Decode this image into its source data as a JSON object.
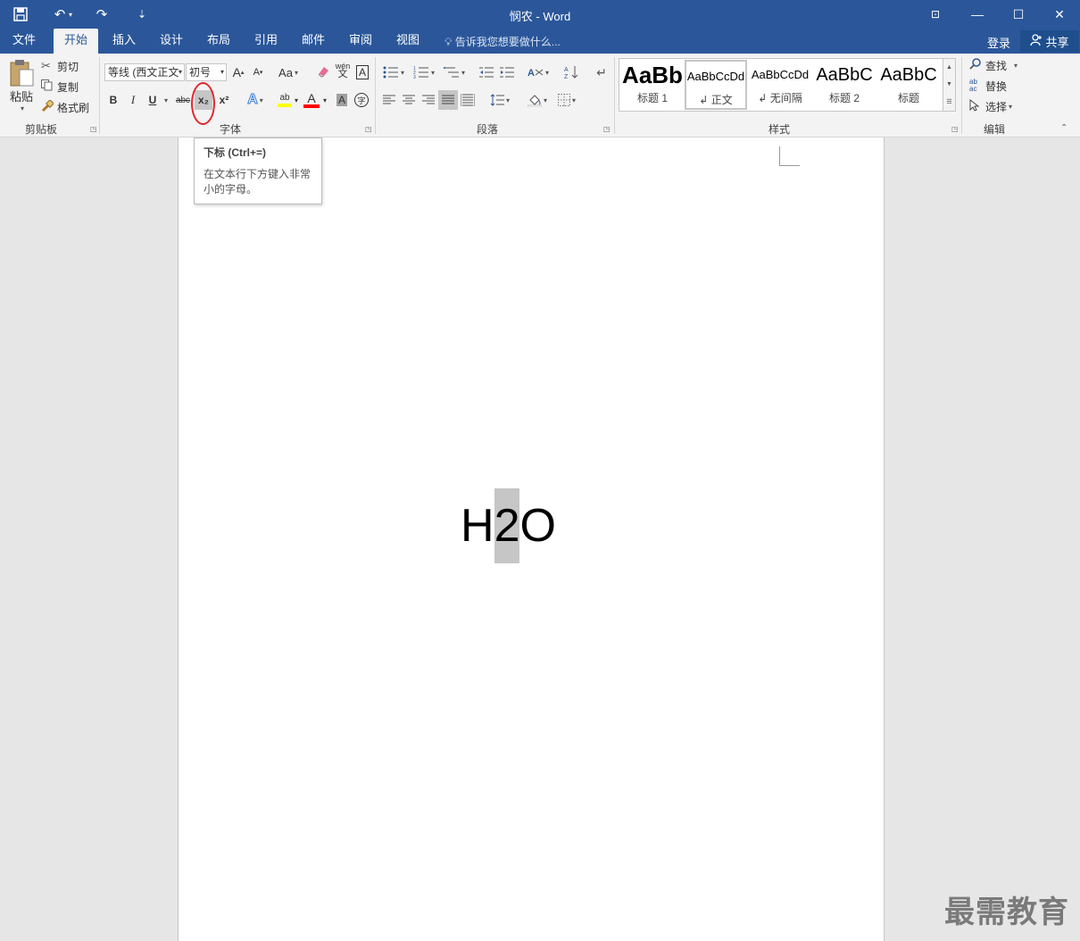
{
  "window": {
    "title": "悯农 - Word",
    "min_icon": "—",
    "max_icon": "☐",
    "close_icon": "✕",
    "ribbon_opts_icon": "⊡"
  },
  "quick_access": {
    "save_icon": "💾",
    "undo_icon": "↶",
    "redo_icon": "↷",
    "customize_icon": "⇣"
  },
  "tabs": [
    {
      "label": "文件"
    },
    {
      "label": "开始"
    },
    {
      "label": "插入"
    },
    {
      "label": "设计"
    },
    {
      "label": "布局"
    },
    {
      "label": "引用"
    },
    {
      "label": "邮件"
    },
    {
      "label": "审阅"
    },
    {
      "label": "视图"
    }
  ],
  "tell_me": "告诉我您想要做什么...",
  "login": "登录",
  "share": "共享",
  "clipboard": {
    "label": "剪贴板",
    "paste": "粘贴",
    "cut": "剪切",
    "copy": "复制",
    "format_painter": "格式刷"
  },
  "font": {
    "label": "字体",
    "font_name": "等线 (西文正文",
    "font_size": "初号",
    "grow": "A",
    "shrink": "A",
    "change_case": "Aa",
    "bold": "B",
    "italic": "I",
    "underline": "U",
    "strikethrough": "abc",
    "subscript": "x₂",
    "superscript": "x²",
    "wen": "wén",
    "wen_char": "文",
    "border_char": "A",
    "circle_char": "字",
    "text_effects": "A",
    "highlight": "ab",
    "font_color": "A",
    "char_shading": "A"
  },
  "paragraph": {
    "label": "段落"
  },
  "styles": {
    "label": "样式",
    "items": [
      {
        "preview": "AaBb",
        "name": "标题 1"
      },
      {
        "preview": "AaBbCcDd",
        "name": "正文"
      },
      {
        "preview": "AaBbCcDd",
        "name": "无间隔"
      },
      {
        "preview": "AaBbC",
        "name": "标题 2"
      },
      {
        "preview": "AaBbC",
        "name": "标题"
      }
    ]
  },
  "editing": {
    "label": "编辑",
    "find": "查找",
    "replace": "替换",
    "select": "选择"
  },
  "tooltip": {
    "title": "下标 (Ctrl+=)",
    "body": "在文本行下方键入非常小的字母。"
  },
  "document": {
    "before": "H",
    "selected": "2",
    "after": "O"
  },
  "watermark": "最需教育",
  "colors": {
    "title_bar": "#2b579a",
    "ribbon": "#f3f3f3",
    "highlight_yellow": "#ffff00",
    "font_color_red": "#ff0000",
    "annotation_red": "#e0262c"
  }
}
